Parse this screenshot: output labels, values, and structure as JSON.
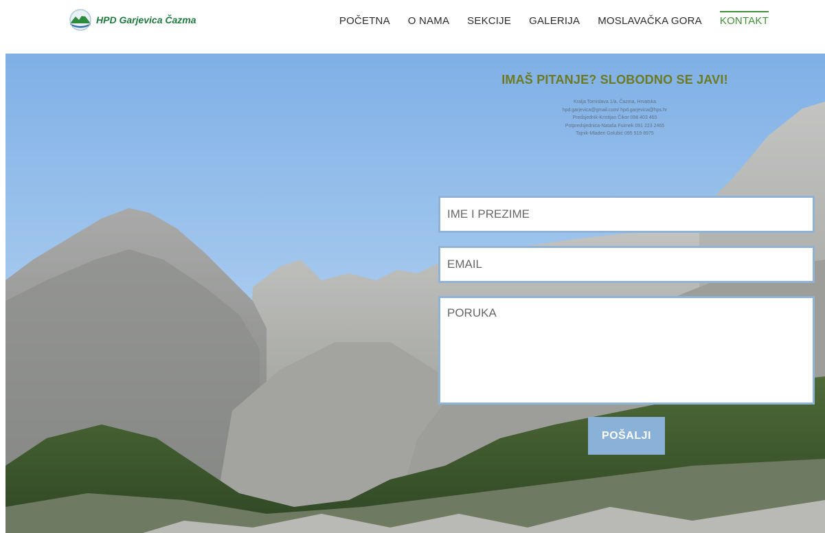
{
  "site": {
    "name": "HPD Garjevica Čazma",
    "logo_icon": "club-emblem-icon"
  },
  "nav": {
    "items": [
      {
        "label": "POČETNA",
        "active": false
      },
      {
        "label": "O NAMA",
        "active": false
      },
      {
        "label": "SEKCIJE",
        "active": false
      },
      {
        "label": "GALERIJA",
        "active": false
      },
      {
        "label": "MOSLAVAČKA GORA",
        "active": false
      },
      {
        "label": "KONTAKT",
        "active": true
      }
    ]
  },
  "contact": {
    "title": "IMAŠ PITANJE? SLOBODNO SE JAVI!",
    "lines": [
      "Kralja Tomislava 1/a, Čazma, Hrvatska",
      "hpd.garjevica@gmail.com/ hpd.garjevica@hps.hr",
      "Predsjednik-Kristijan Čikor 098 403 465",
      "Potpredsjednica-Nataša Fuimek 091 223 2465",
      "Tajnik-Mladen Golubić 095 519 8975"
    ]
  },
  "form": {
    "name_placeholder": "IME I PREZIME",
    "email_placeholder": "EMAIL",
    "message_placeholder": "PORUKA",
    "submit_label": "POŠALJI"
  },
  "colors": {
    "accent_green": "#3f8f35",
    "title_olive": "#6d7a22",
    "button_blue": "#8ab2d9",
    "field_border": "#8fb3d6",
    "sky": "#7fb0e6"
  }
}
